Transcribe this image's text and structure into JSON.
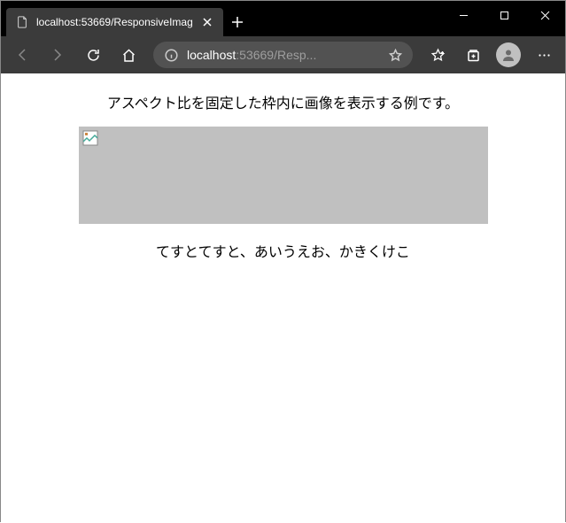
{
  "browser": {
    "tab_title": "localhost:53669/ResponsiveImag",
    "address": {
      "host": "localhost",
      "port_path": ":53669/Resp..."
    }
  },
  "page": {
    "heading": "アスペクト比を固定した枠内に画像を表示する例です。",
    "body_text": "てすとてすと、あいうえお、かきくけこ"
  }
}
